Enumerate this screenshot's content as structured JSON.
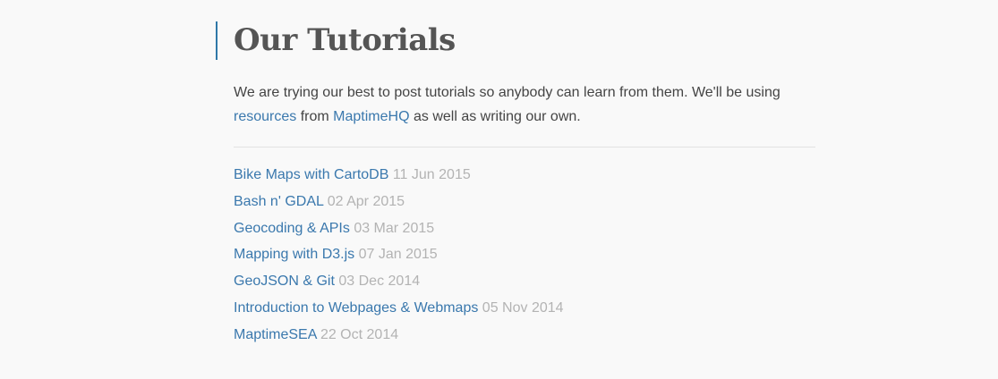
{
  "page": {
    "title": "Our Tutorials"
  },
  "intro": {
    "text_before": "We are trying our best to post tutorials so anybody can learn from them. We'll be using",
    "link_resources": "resources",
    "text_middle": "from",
    "link_maptimehq": "MaptimeHQ",
    "text_after": "as well as writing our own."
  },
  "posts": [
    {
      "title": "Bike Maps with CartoDB",
      "date": "11 Jun 2015"
    },
    {
      "title": "Bash n' GDAL",
      "date": "02 Apr 2015"
    },
    {
      "title": "Geocoding & APIs",
      "date": "03 Mar 2015"
    },
    {
      "title": "Mapping with D3.js",
      "date": "07 Jan 2015"
    },
    {
      "title": "GeoJSON & Git",
      "date": "03 Dec 2014"
    },
    {
      "title": "Introduction to Webpages & Webmaps",
      "date": "05 Nov 2014"
    },
    {
      "title": "MaptimeSEA",
      "date": "22 Oct 2014"
    }
  ],
  "colors": {
    "link": "#3a78ad",
    "accent_border": "#2f78a8",
    "date": "#b3b3b3",
    "background": "#f9f9f9"
  }
}
